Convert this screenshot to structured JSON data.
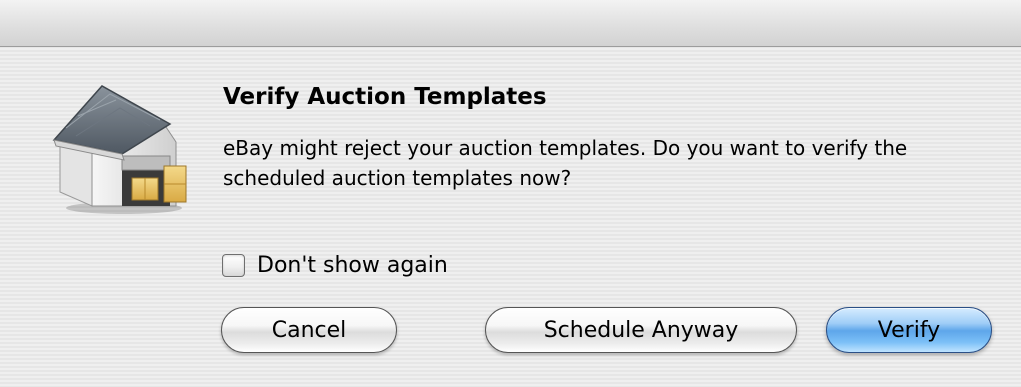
{
  "dialog": {
    "title": "Verify Auction Templates",
    "message": "eBay might reject your auction templates. Do you want to verify the scheduled auction templates now?",
    "icon": "garage-with-boxes-icon"
  },
  "checkbox": {
    "label": "Don't show again",
    "checked": false
  },
  "buttons": {
    "cancel": "Cancel",
    "schedule": "Schedule Anyway",
    "verify": "Verify"
  },
  "colors": {
    "default_button": "#5ea6ea",
    "background": "#ececec"
  }
}
